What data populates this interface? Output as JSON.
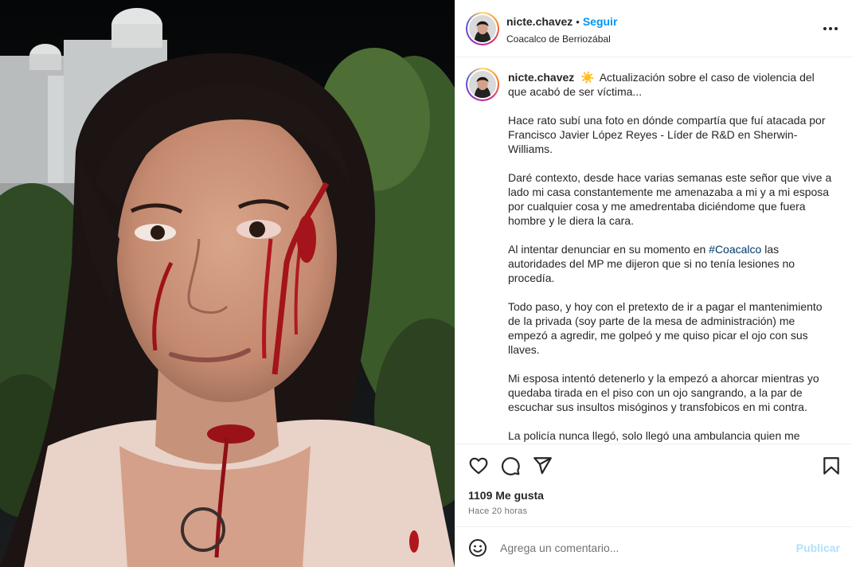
{
  "post": {
    "author": {
      "username": "nicte.chavez",
      "location": "Coacalco de Berriozábal"
    },
    "follow_label": "Seguir",
    "separator": "•",
    "caption": {
      "username": "nicte.chavez",
      "sun_emoji": "☀️",
      "intro": "Actualización sobre el caso de violencia del que acabó de ser víctima...",
      "paragraph_1": "Hace rato subí una foto en dónde compartía que fuí atacada por Francisco Javier López Reyes - Líder de R&D en Sherwin-Williams.",
      "paragraph_2": "Daré contexto, desde hace varias semanas este señor que vive a lado mi casa constantemente me amenazaba a mi y a mi esposa por cualquier cosa y me amedrentaba diciéndome que fuera hombre y le diera la cara.",
      "paragraph_3_before": "Al intentar denunciar en su momento en ",
      "paragraph_3_hashtag": "#Coacalco",
      "paragraph_3_after": " las autoridades del MP me dijeron que si no tenía lesiones no procedía.",
      "paragraph_4": "Todo paso, y hoy con el pretexto de ir a pagar el mantenimiento de la privada (soy parte de la mesa de administración) me empezó a agredir, me golpeó y me quiso picar el ojo con sus llaves.",
      "paragraph_5": "Mi esposa intentó detenerlo y la empezó a ahorcar mientras yo quedaba tirada en el piso con un ojo sangrando, a la par de escuchar sus insultos misóginos y transfobicos en mi contra.",
      "paragraph_6": "La policía nunca llegó, solo llegó una ambulancia quien me"
    },
    "likes_label": "1109 Me gusta",
    "time_label": "Hace 20 horas",
    "comment": {
      "placeholder": "Agrega un comentario...",
      "publish_label": "Publicar"
    },
    "icons": {
      "like": "heart-icon",
      "comment": "comment-icon",
      "share": "share-icon",
      "save": "bookmark-icon",
      "more": "more-options-icon",
      "emoji": "emoji-icon"
    },
    "colors": {
      "link_blue": "#0095f6",
      "hashtag": "#00376b",
      "publish_disabled": "#b2dffc",
      "muted": "#737373"
    }
  }
}
